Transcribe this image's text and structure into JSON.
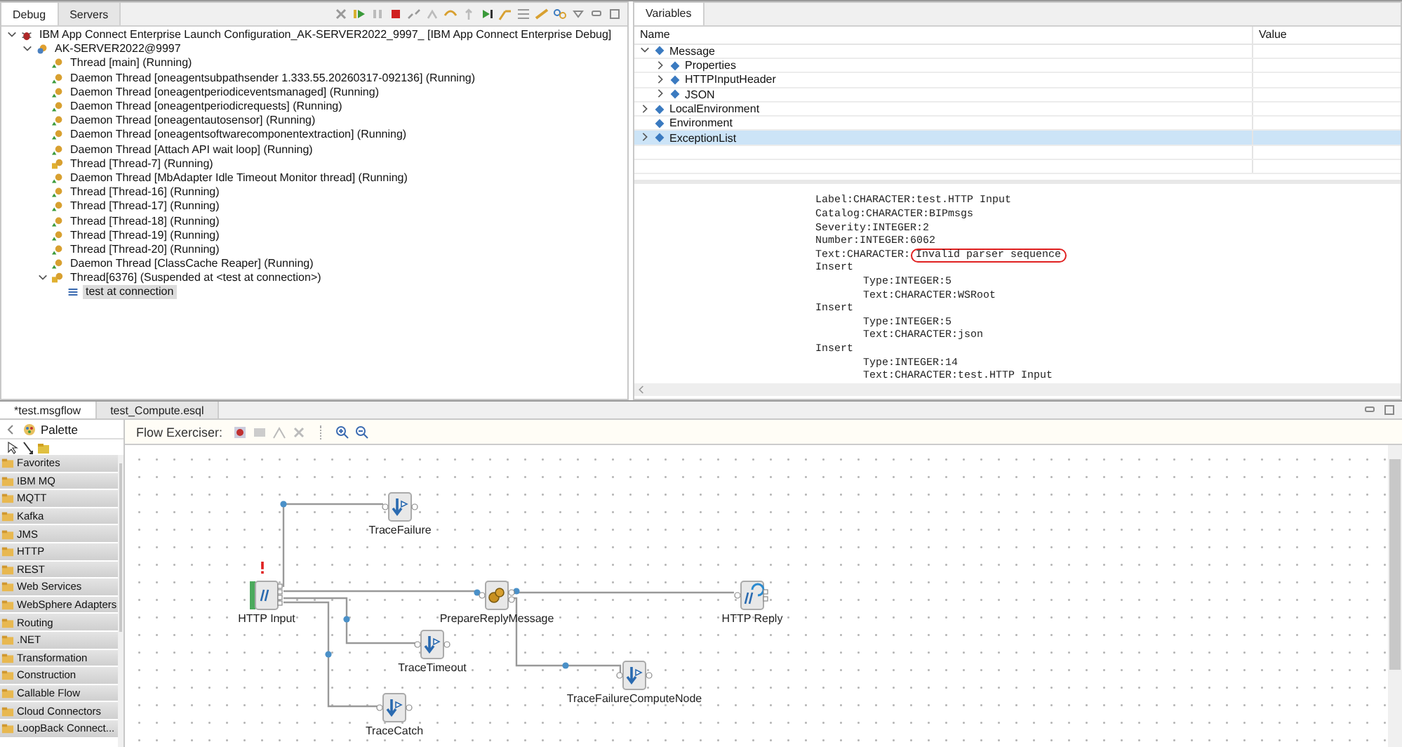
{
  "debug_view": {
    "tabs": [
      {
        "label": "Debug",
        "selected": true
      },
      {
        "label": "Servers",
        "selected": false
      }
    ],
    "tree": [
      {
        "label": "IBM App Connect Enterprise Launch Configuration_AK-SERVER2022_9997_ [IBM App Connect Enterprise Debug]",
        "kind": "launch",
        "expanded": true,
        "selected": false,
        "children": [
          {
            "label": "AK-SERVER2022@9997",
            "kind": "server",
            "expanded": true,
            "selected": false,
            "children": [
              {
                "label": "Thread [main] (Running)",
                "kind": "running",
                "selected": false
              },
              {
                "label": "Daemon Thread [oneagentsubpathsender 1.333.55.20260317-092136] (Running)",
                "kind": "running",
                "selected": false
              },
              {
                "label": "Daemon Thread [oneagentperiodiceventsmanaged] (Running)",
                "kind": "running",
                "selected": false
              },
              {
                "label": "Daemon Thread [oneagentperiodicrequests] (Running)",
                "kind": "running",
                "selected": false
              },
              {
                "label": "Daemon Thread [oneagentautosensor] (Running)",
                "kind": "running",
                "selected": false
              },
              {
                "label": "Daemon Thread [oneagentsoftwarecomponentextraction] (Running)",
                "kind": "running",
                "selected": false
              },
              {
                "label": "Daemon Thread [Attach API wait loop] (Running)",
                "kind": "running",
                "selected": false
              },
              {
                "label": "Thread [Thread-7] (Running)",
                "kind": "group",
                "selected": false
              },
              {
                "label": "Daemon Thread [MbAdapter Idle Timeout Monitor thread] (Running)",
                "kind": "running",
                "selected": false
              },
              {
                "label": "Thread [Thread-16] (Running)",
                "kind": "running",
                "selected": false
              },
              {
                "label": "Thread [Thread-17] (Running)",
                "kind": "running",
                "selected": false
              },
              {
                "label": "Thread [Thread-18] (Running)",
                "kind": "running",
                "selected": false
              },
              {
                "label": "Thread [Thread-19] (Running)",
                "kind": "running",
                "selected": false
              },
              {
                "label": "Thread [Thread-20] (Running)",
                "kind": "running",
                "selected": false
              },
              {
                "label": "Daemon Thread [ClassCache Reaper] (Running)",
                "kind": "running",
                "selected": false
              },
              {
                "label": "Thread[6376] (Suspended at <test at connection>)",
                "kind": "group",
                "expanded": true,
                "selected": false,
                "children": [
                  {
                    "label": "test at connection",
                    "kind": "frame",
                    "selected": true
                  }
                ]
              }
            ]
          }
        ]
      }
    ]
  },
  "variables_view": {
    "tab": "Variables",
    "columns": [
      "Name",
      "Value"
    ],
    "tree": [
      {
        "name": "Message",
        "expanded": true,
        "selected": false,
        "children": [
          {
            "name": "Properties",
            "expanded": false,
            "selected": false
          },
          {
            "name": "HTTPInputHeader",
            "expanded": false,
            "selected": false
          },
          {
            "name": "JSON",
            "expanded": false,
            "selected": false
          }
        ]
      },
      {
        "name": "LocalEnvironment",
        "expanded": false,
        "selected": false
      },
      {
        "name": "Environment",
        "selected": false
      },
      {
        "name": "ExceptionList",
        "expanded": false,
        "selected": true
      }
    ],
    "detail_lines": [
      {
        "text": "Label:CHARACTER:test.HTTP Input"
      },
      {
        "text": "Catalog:CHARACTER:BIPmsgs"
      },
      {
        "text": "Severity:INTEGER:2"
      },
      {
        "text": "Number:INTEGER:6062"
      },
      {
        "text": "Text:CHARACTER:",
        "highlight": "Invalid parser sequence"
      },
      {
        "text": "Insert",
        "children": [
          {
            "text": "Type:INTEGER:5"
          },
          {
            "text": "Text:CHARACTER:WSRoot"
          }
        ]
      },
      {
        "text": "Insert",
        "children": [
          {
            "text": "Type:INTEGER:5"
          },
          {
            "text": "Text:CHARACTER:json"
          }
        ]
      },
      {
        "text": "Insert",
        "children": [
          {
            "text": "Type:INTEGER:14"
          },
          {
            "text": "Text:CHARACTER:test.HTTP Input"
          }
        ]
      }
    ]
  },
  "editor": {
    "tabs": [
      {
        "label": "*test.msgflow",
        "selected": true
      },
      {
        "label": "test_Compute.esql",
        "selected": false
      }
    ],
    "palette": {
      "title": "Palette",
      "drawers": [
        "Favorites",
        "IBM MQ",
        "MQTT",
        "Kafka",
        "JMS",
        "HTTP",
        "REST",
        "Web Services",
        "WebSphere Adapters",
        "Routing",
        ".NET",
        "Transformation",
        "Construction",
        "Callable Flow",
        "Cloud Connectors",
        "LoopBack Connect..."
      ]
    },
    "flow_exerciser_label": "Flow Exerciser:",
    "nodes": [
      {
        "label": "HTTP Input",
        "kind": "http-input",
        "warning": true
      },
      {
        "label": "TraceFailure",
        "kind": "trace",
        "warning": false
      },
      {
        "label": "PrepareReplyMessage",
        "kind": "compute",
        "warning": false
      },
      {
        "label": "HTTP Reply",
        "kind": "http-reply",
        "warning": false
      },
      {
        "label": "TraceTimeout",
        "kind": "trace",
        "warning": false
      },
      {
        "label": "TraceCatch",
        "kind": "trace",
        "warning": false
      },
      {
        "label": "TraceFailureComputeNode",
        "kind": "trace",
        "warning": false
      }
    ]
  }
}
